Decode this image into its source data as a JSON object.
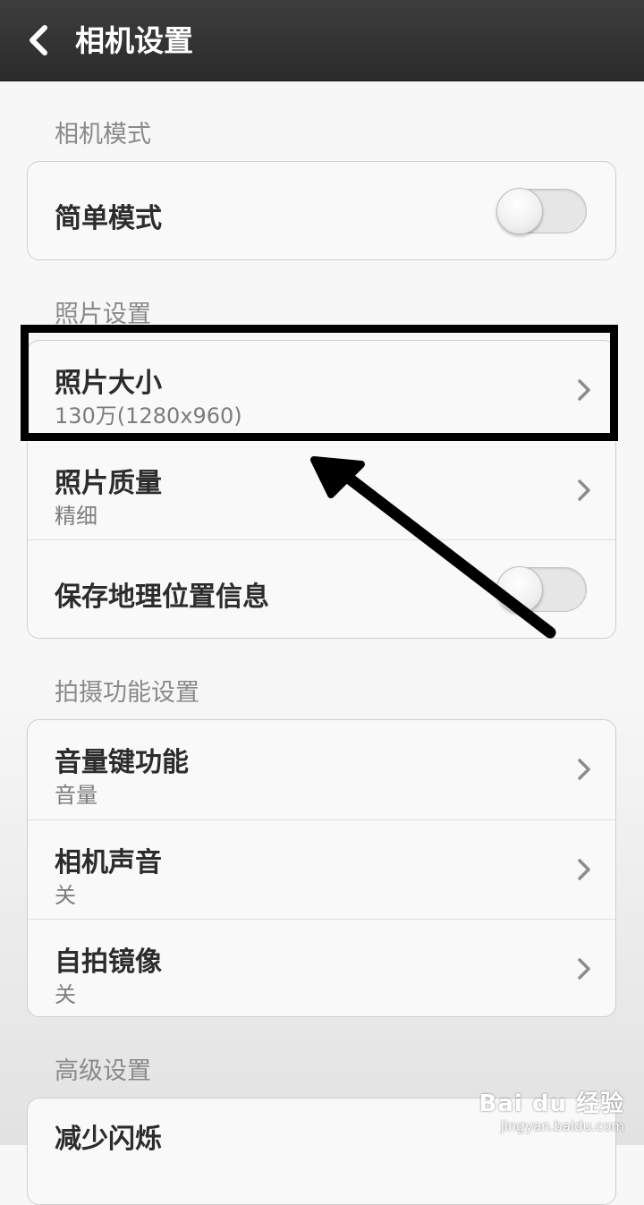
{
  "header": {
    "title": "相机设置",
    "back_icon": "chevron-left-icon"
  },
  "sections": {
    "camera_mode": {
      "label": "相机模式",
      "rows": {
        "simple_mode": {
          "title": "简单模式",
          "toggle_on": false
        }
      }
    },
    "photo": {
      "label": "照片设置",
      "rows": {
        "size": {
          "title": "照片大小",
          "value": "130万(1280x960)"
        },
        "quality": {
          "title": "照片质量",
          "value": "精细"
        },
        "geo": {
          "title": "保存地理位置信息",
          "toggle_on": false
        }
      }
    },
    "shooting": {
      "label": "拍摄功能设置",
      "rows": {
        "volume_key": {
          "title": "音量键功能",
          "value": "音量"
        },
        "sound": {
          "title": "相机声音",
          "value": "关"
        },
        "mirror": {
          "title": "自拍镜像",
          "value": "关"
        }
      }
    },
    "advanced": {
      "label": "高级设置",
      "rows": {
        "flicker": {
          "title": "减少闪烁"
        }
      }
    }
  },
  "watermark": {
    "brand": "Bai du 经验",
    "url": "jingyan.baidu.com"
  },
  "colors": {
    "header_bg": "#333333",
    "annotation": "#000000"
  }
}
